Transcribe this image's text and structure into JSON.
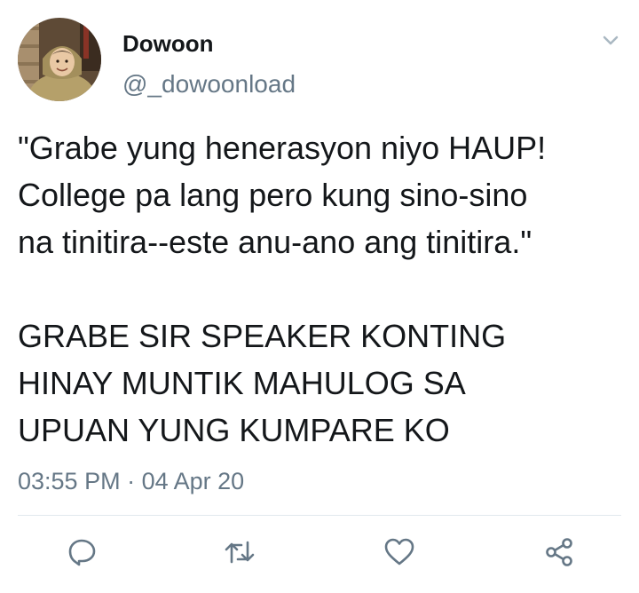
{
  "user": {
    "display_name": "Dowoon",
    "handle": "@_dowoonload"
  },
  "tweet": {
    "paragraph1_lines": [
      "\"Grabe yung henerasyon niyo HAUP!",
      "College pa lang pero kung sino-sino",
      "na tinitira--este anu-ano ang tinitira.\""
    ],
    "paragraph2_lines": [
      "GRABE SIR SPEAKER KONTING",
      "HINAY MUNTIK MAHULOG SA",
      "UPUAN YUNG KUMPARE KO"
    ],
    "time": "03:55 PM",
    "separator": "·",
    "date": "04 Apr 20"
  },
  "actions": [
    {
      "name": "reply",
      "icon": "reply-icon"
    },
    {
      "name": "retweet",
      "icon": "retweet-icon"
    },
    {
      "name": "like",
      "icon": "heart-icon"
    },
    {
      "name": "share",
      "icon": "share-icon"
    }
  ],
  "colors": {
    "text_primary": "#14171a",
    "text_secondary": "#657786",
    "icon": "#657786",
    "divider": "#e1e8ed"
  }
}
